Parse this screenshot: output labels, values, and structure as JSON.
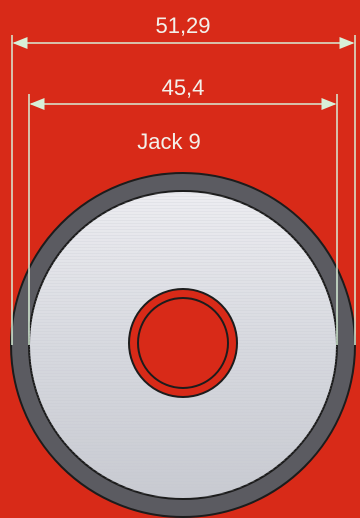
{
  "dimensions": {
    "outer": "51,29",
    "inner": "45,4"
  },
  "part_label": "Jack 9",
  "colors": {
    "background": "#d82a18",
    "outer_ring": "#5b5b61",
    "disc_face": "#d8dae0",
    "center_hole": "#d82a18",
    "outline": "#1c1c1c",
    "dimension_line": "#d8f0d8",
    "text": "#f3f0ea"
  }
}
